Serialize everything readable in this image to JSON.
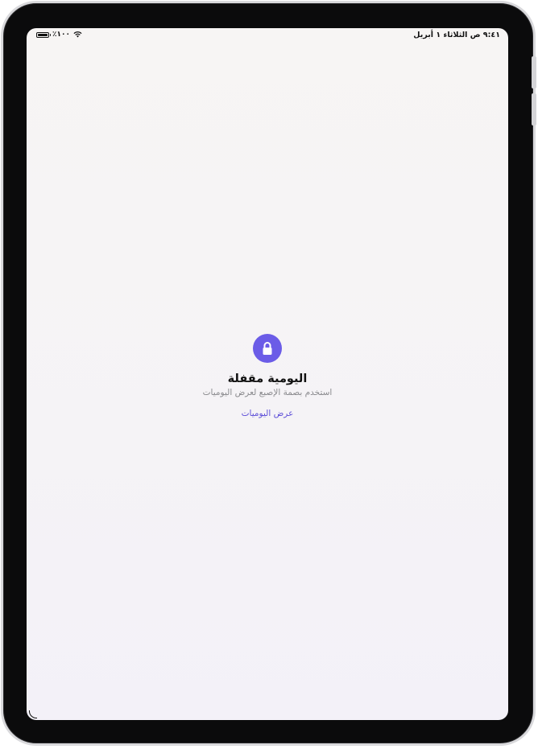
{
  "status_bar": {
    "time_date": "٩:٤١ ص  الثلاثاء ١ أبريل",
    "battery_percent": "٪١٠٠",
    "battery_level": 1.0,
    "wifi_icon": "wifi-icon",
    "battery_icon": "battery-icon"
  },
  "lock_screen": {
    "icon": "lock-icon",
    "accent_color": "#6b5ce7",
    "title": "اليومية مقفلة",
    "subtitle": "استخدم بصمة الإصبع لعرض اليوميات",
    "view_button_label": "عرض اليوميات"
  }
}
